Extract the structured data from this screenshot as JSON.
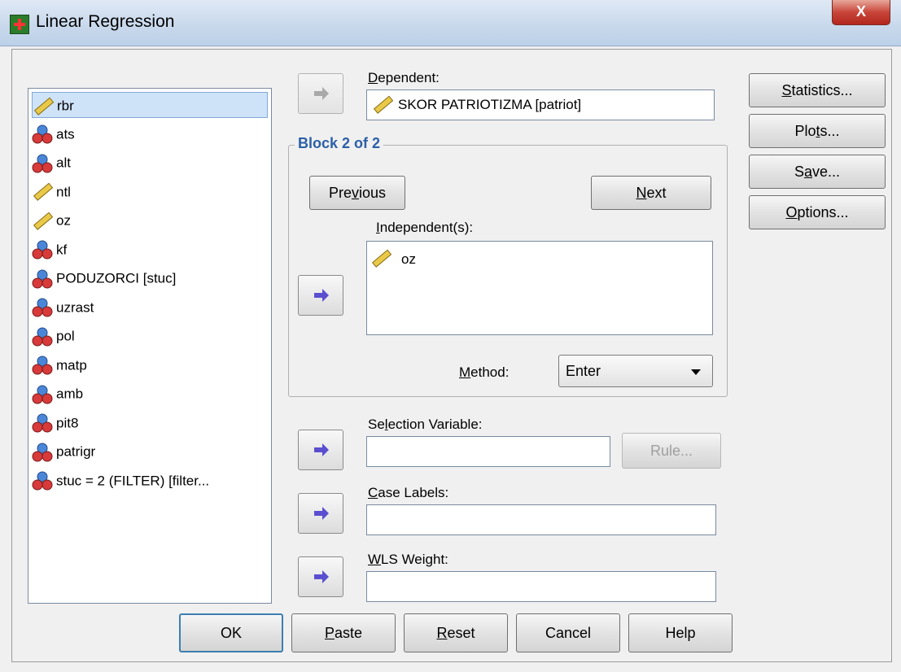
{
  "window": {
    "title": "Linear Regression",
    "close_label": "X"
  },
  "variables": [
    {
      "label": "rbr",
      "icon": "scale-icon",
      "selected": true
    },
    {
      "label": "ats",
      "icon": "nominal-icon"
    },
    {
      "label": "alt",
      "icon": "nominal-icon"
    },
    {
      "label": "ntl",
      "icon": "scale-icon"
    },
    {
      "label": "oz",
      "icon": "scale-icon"
    },
    {
      "label": "kf",
      "icon": "nominal-icon"
    },
    {
      "label": "PODUZORCI [stuc]",
      "icon": "nominal-icon"
    },
    {
      "label": "uzrast",
      "icon": "nominal-icon"
    },
    {
      "label": "pol",
      "icon": "nominal-icon"
    },
    {
      "label": "matp",
      "icon": "nominal-icon"
    },
    {
      "label": "amb",
      "icon": "nominal-icon"
    },
    {
      "label": "pit8",
      "icon": "nominal-icon"
    },
    {
      "label": "patrigr",
      "icon": "nominal-icon"
    },
    {
      "label": "stuc = 2 (FILTER) [filter...",
      "icon": "nominal-icon"
    }
  ],
  "dependent": {
    "label": "Dependent:",
    "value": "SKOR PATRIOTIZMA [patriot]"
  },
  "block": {
    "title": "Block 2 of 2",
    "previous": "Previous",
    "next": "Next",
    "independents_label": "Independent(s):",
    "independents": [
      "oz"
    ],
    "method_label": "Method:",
    "method_value": "Enter"
  },
  "selection": {
    "label": "Selection Variable:",
    "rule": "Rule..."
  },
  "case_labels": {
    "label": "Case Labels:"
  },
  "wls": {
    "label": "WLS Weight:"
  },
  "side_buttons": {
    "statistics": "Statistics...",
    "plots": "Plots...",
    "save": "Save...",
    "options": "Options..."
  },
  "bottom_buttons": {
    "ok": "OK",
    "paste": "Paste",
    "reset": "Reset",
    "cancel": "Cancel",
    "help": "Help"
  },
  "colors": {
    "accent": "#2b5fa8",
    "arrow": "#5a4fcf",
    "selection": "#cfe3f8"
  }
}
